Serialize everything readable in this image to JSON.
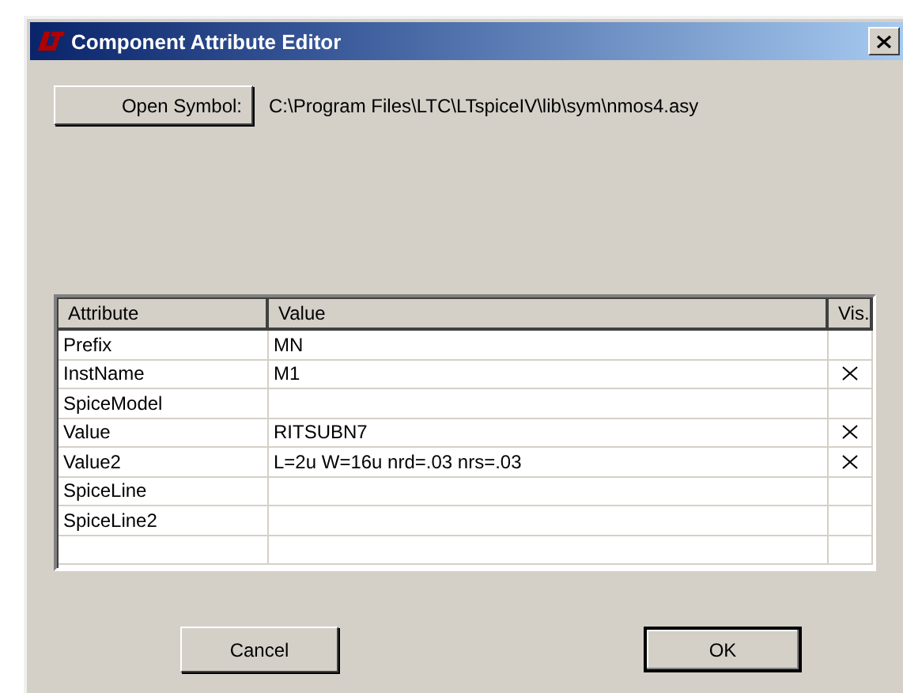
{
  "window": {
    "title": "Component Attribute Editor"
  },
  "open_symbol_button": "Open Symbol:",
  "symbol_path": "C:\\Program Files\\LTC\\LTspiceIV\\lib\\sym\\nmos4.asy",
  "table": {
    "columns": [
      "Attribute",
      "Value",
      "Vis."
    ],
    "rows": [
      {
        "attribute": "Prefix",
        "value": "MN",
        "visible": false
      },
      {
        "attribute": "InstName",
        "value": "M1",
        "visible": true
      },
      {
        "attribute": "SpiceModel",
        "visible": false
      },
      {
        "attribute": "Value",
        "value": "RITSUBN7",
        "visible": true
      },
      {
        "attribute": "Value2",
        "value": "L=2u W=16u nrd=.03 nrs=.03",
        "visible": true
      },
      {
        "attribute": "SpiceLine",
        "visible": false
      },
      {
        "attribute": "SpiceLine2",
        "visible": false
      }
    ]
  },
  "buttons": [
    {
      "label": "Cancel",
      "default": false
    },
    {
      "label": "OK",
      "default": true
    }
  ]
}
